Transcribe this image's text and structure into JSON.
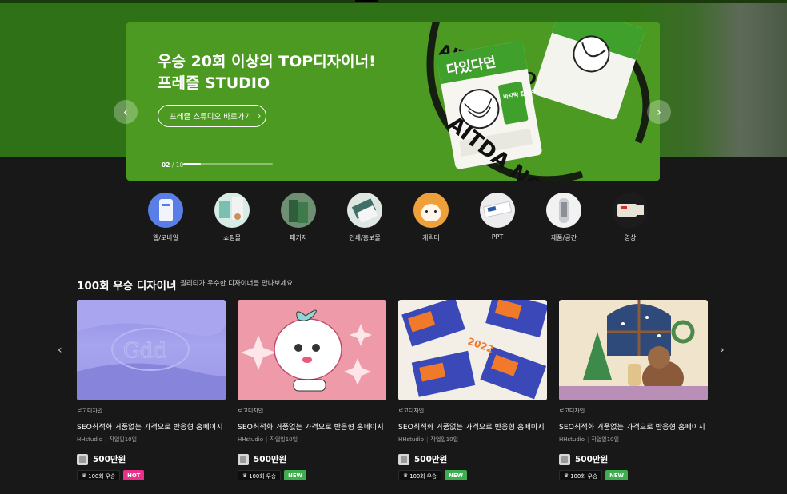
{
  "banner": {
    "title_line1": "우승 20회 이상의 TOP디자이너!",
    "title_line2": "프레즐 STUDIO",
    "button_label": "프레즐 스튜디오 바로가기",
    "page_current": "02",
    "page_separator": "/",
    "page_total": "10",
    "progress": 0.2,
    "art_pack_title": "다있다면",
    "art_pack_sub": "바지락 칼국수",
    "art_swirl_text": "AITDA NOODLE",
    "art_overlay_text": "AITDA NO"
  },
  "categories": [
    {
      "label": "웹/모바일",
      "icon": "web-mobile-thumb"
    },
    {
      "label": "쇼핑몰",
      "icon": "shopping-mall-thumb"
    },
    {
      "label": "패키지",
      "icon": "package-thumb"
    },
    {
      "label": "인쇄/홍보물",
      "icon": "print-promo-thumb"
    },
    {
      "label": "캐릭터",
      "icon": "character-thumb"
    },
    {
      "label": "PPT",
      "icon": "ppt-thumb"
    },
    {
      "label": "제품/공간",
      "icon": "product-space-thumb"
    },
    {
      "label": "영상",
      "icon": "video-thumb"
    }
  ],
  "section": {
    "title": "100회 우승 디자이너",
    "subtitle": "퀄리티가 우수한 디자이너를 만나보세요."
  },
  "cards": [
    {
      "category": "로고디자인",
      "title": "SEO최적화 거품없는 가격으로 반응형 홈페이지 ...",
      "studio": "HHstudio",
      "duration": "작업일10일",
      "price": "500만원",
      "badge_win": "100회 우승",
      "badge_tag": "HOT",
      "thumb_text": "Gdd"
    },
    {
      "category": "로고디자인",
      "title": "SEO최적화 거품없는 가격으로 반응형 홈페이지 ...",
      "studio": "HHstudio",
      "duration": "작업일10일",
      "price": "500만원",
      "badge_win": "100회 우승",
      "badge_tag": "NEW"
    },
    {
      "category": "로고디자인",
      "title": "SEO최적화 거품없는 가격으로 반응형 홈페이지 ...",
      "studio": "HHstudio",
      "duration": "작업일10일",
      "price": "500만원",
      "badge_win": "100회 우승",
      "badge_tag": "NEW",
      "thumb_text": "2022"
    },
    {
      "category": "로고디자인",
      "title": "SEO최적화 거품없는 가격으로 반응형 홈페이지 ...",
      "studio": "HHstudio",
      "duration": "작업일10일",
      "price": "500만원",
      "badge_win": "100회 우승",
      "badge_tag": "NEW"
    }
  ],
  "colors": {
    "hero_bg": "#2f7116",
    "banner_bg": "#4d9a22",
    "page_bg": "#181818",
    "hot": "#e8328a",
    "new": "#3fae4e"
  }
}
